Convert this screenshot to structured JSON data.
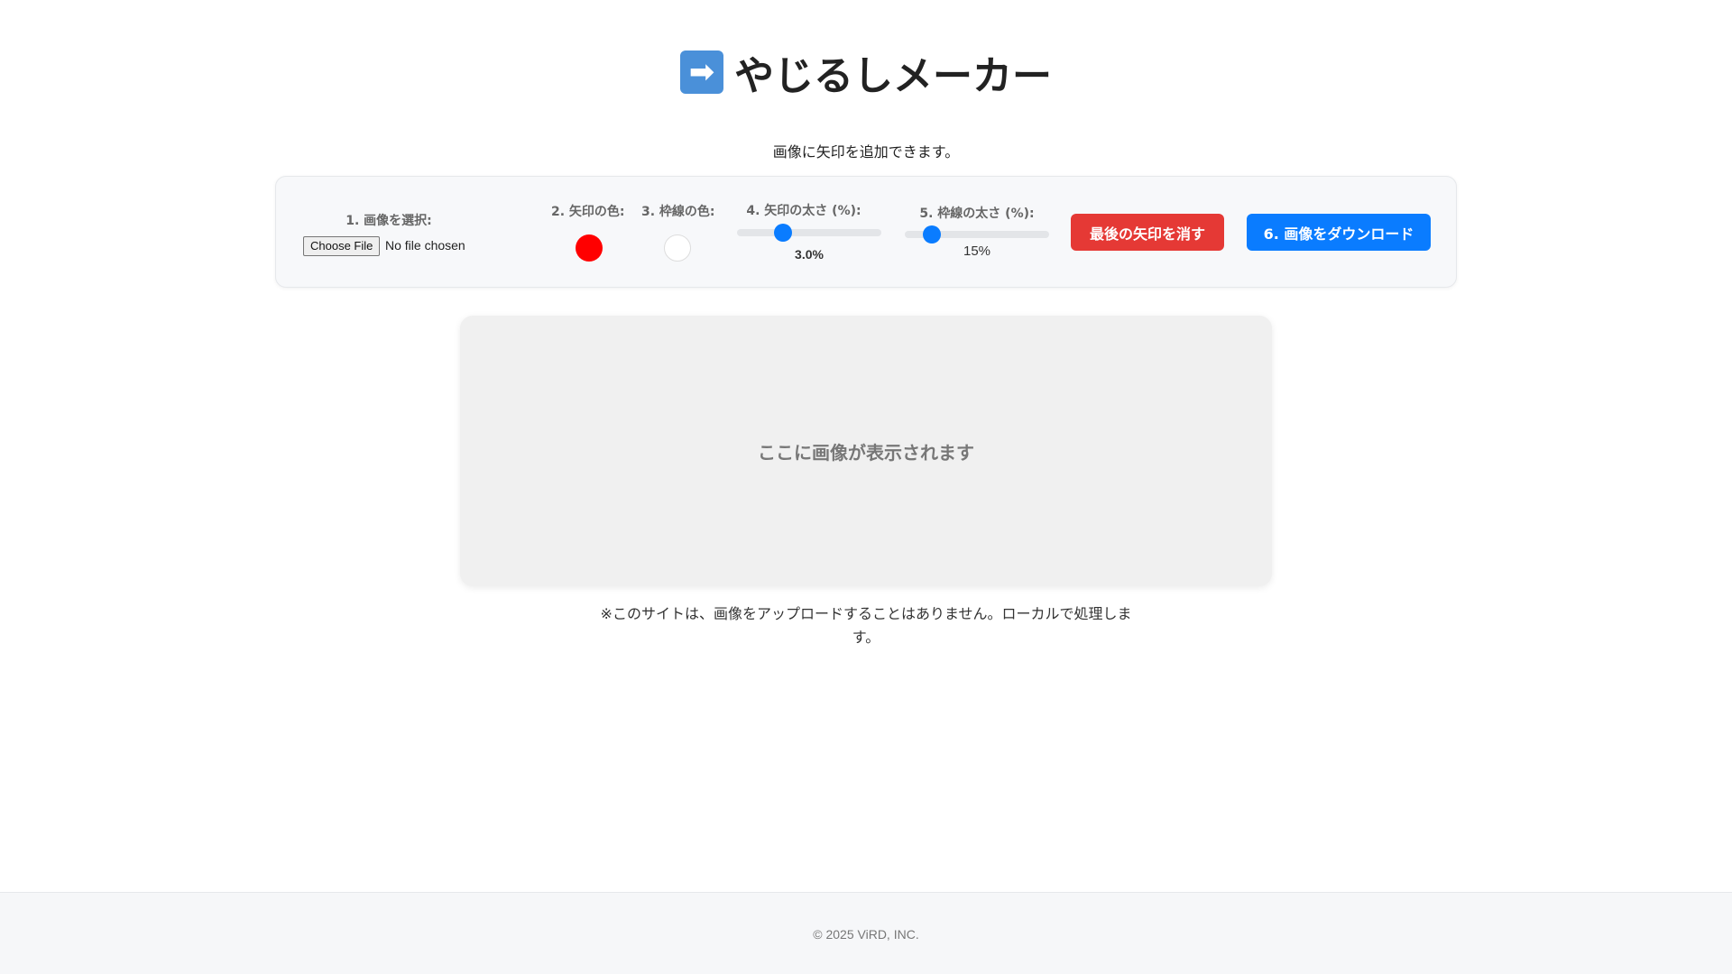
{
  "header": {
    "emoji": "➡",
    "title": "やじるしメーカー",
    "subtitle": "画像に矢印を追加できます。"
  },
  "controls": {
    "file": {
      "label": "1. 画像を選択:",
      "button_label": "Choose File",
      "status": "No file chosen"
    },
    "arrow_color": {
      "label": "2. 矢印の色:",
      "value": "#ff0000"
    },
    "border_color": {
      "label": "3. 枠線の色:",
      "value": "#ffffff"
    },
    "arrow_thickness": {
      "label": "4. 矢印の太さ (%):",
      "value_text": "3.0%",
      "value": 3.0,
      "fraction": 0.32
    },
    "border_thickness": {
      "label": "5. 枠線の太さ (%):",
      "value_text": "15%",
      "value": 15,
      "fraction": 0.19
    },
    "undo_label": "最後の矢印を消す",
    "download_label": "6. 画像をダウンロード"
  },
  "preview": {
    "placeholder": "ここに画像が表示されます"
  },
  "notice": "※このサイトは、画像をアップロードすることはありません。ローカルで処理します。",
  "footer": {
    "copyright": "© 2025 ViRD, INC."
  },
  "colors": {
    "accent": "#0a7cff",
    "danger": "#e53935"
  }
}
